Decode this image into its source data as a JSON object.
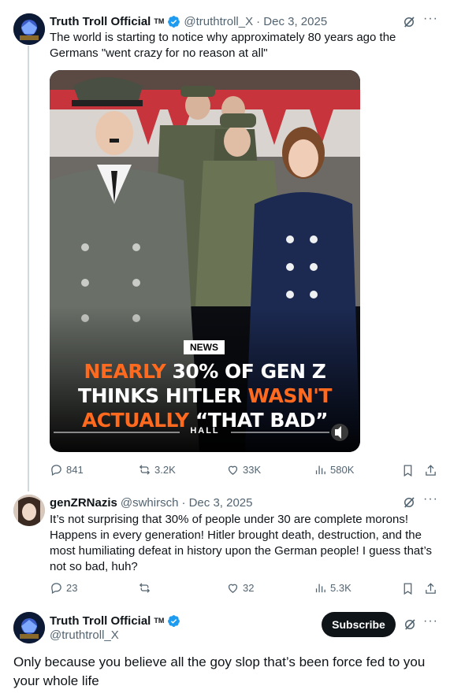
{
  "colors": {
    "text": "#0f1419",
    "muted": "#536471",
    "verified": "#1d9bf0",
    "orange": "#ff6a1f",
    "line": "#cfd9de"
  },
  "tweet1": {
    "author": "Truth Troll Official",
    "tm": "TM",
    "handle": "@truthtroll_X",
    "date": "· Dec 3, 2025",
    "text": "The world is starting to notice why approximately 80 years ago the Germans \"went crazy for no reason at all\"",
    "media": {
      "badge": "NEWS",
      "line1_orange": "NEARLY ",
      "line1_white": "30% OF GEN Z",
      "line2_white": "THINKS HITLER ",
      "line2_orange": "WASN'T",
      "line3_orange": "ACTUALLY ",
      "line3_white": "“THAT BAD”",
      "watermark": "HALL"
    },
    "stats": {
      "replies": "841",
      "reposts": "3.2K",
      "likes": "33K",
      "views": "580K"
    }
  },
  "tweet2": {
    "author": "genZRNazis",
    "handle": "@swhirsch",
    "date": "· Dec 3, 2025",
    "text": "It’s not surprising that 30% of people under 30 are complete morons! Happens in every generation!  Hitler brought death, destruction, and the most humiliating defeat in history upon the German people! I guess that’s not so bad, huh?",
    "stats": {
      "replies": "23",
      "reposts": "",
      "likes": "32",
      "views": "5.3K"
    }
  },
  "tweet3": {
    "author": "Truth Troll Official",
    "tm": "TM",
    "handle": "@truthtroll_X",
    "subscribe_label": "Subscribe",
    "text": "Only because you believe all the goy slop that’s been force fed to you your whole life"
  },
  "icons": {
    "reply": "reply-icon",
    "repost": "repost-icon",
    "like": "heart-icon",
    "views": "views-icon",
    "bookmark": "bookmark-icon",
    "share": "share-icon",
    "grok": "grok-icon",
    "more": "more-icon",
    "verified": "verified-badge-icon"
  }
}
